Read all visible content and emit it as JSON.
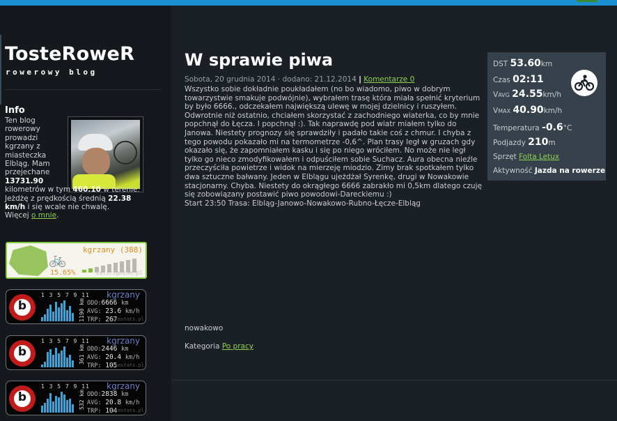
{
  "site": {
    "title": "TosteRoweR",
    "subtitle": "rowerowy blog"
  },
  "info": {
    "heading": "Info",
    "t1": "Ten blog rowerowy prowadzi kgrzany z miasteczka Elbląg. Mam przejechane ",
    "total_km": "13731.90",
    "t2": " kilometrów w tym ",
    "terrain_km": "460.10",
    "t3": " w terenie. Jeżdżę z prędkością średnią ",
    "avg_speed": "22.38 km/h",
    "t4": " i się wcale nie chwalę.",
    "more_prefix": "Więcej ",
    "more_link": "o mnie",
    "more_suffix": "."
  },
  "zaliczgmine": {
    "user": "kgrzany (388)",
    "percent": "15.65%",
    "domain": "zaliczgmine.pl",
    "level_fraction": 0.2
  },
  "bikestats": [
    {
      "user": "kgrzany",
      "months": "1 3 5 7 9 11",
      "year_km": "1190 km",
      "odo_label": "ODO:",
      "odo": "6666",
      "odo_unit": "km",
      "avg_label": "AVG:",
      "avg": "23.6",
      "avg_unit": "km/h",
      "trp_label": "TRP:",
      "trp": "267",
      "domain": "bikestats.pl"
    },
    {
      "user": "kgrzany",
      "months": "1 3 5 7 9 11",
      "year_km": "361 km",
      "odo_label": "ODO:",
      "odo": "2446",
      "odo_unit": "km",
      "avg_label": "AVG:",
      "avg": "20.4",
      "avg_unit": "km/h",
      "trp_label": "TRP:",
      "trp": "105",
      "domain": "bikestats.pl"
    },
    {
      "user": "kgrzany",
      "months": "1 3 5 7 9 11",
      "year_km": "532 km",
      "odo_label": "ODO:",
      "odo": "2838",
      "odo_unit": "km",
      "avg_label": "AVG:",
      "avg": "20.8",
      "avg_unit": "km/h",
      "trp_label": "TRP:",
      "trp": "104",
      "domain": "bikestats.pl"
    }
  ],
  "post": {
    "title": "W sprawie piwa",
    "date": "Sobota, 20 grudnia 2014 · dodano: 21.12.2014",
    "pipe": "|",
    "comments": "Komentarze 0",
    "body": "Wszystko sobie dokładnie poukładałem (no bo wiadomo, piwo w dobrym towarzystwie smakuje podwójnie), wybrałem trasę która miała spełnić kryterium by było 6666., odczekałem największą ulewę w mojej dzielnicy i ruszyłem. Odwrotnie niż ostatnio, chciałem skorzystać z zachodniego wiaterka, co by mnie popchnął do Łęcza. I popchnął :). Tak naprawdę pod wiatr miałem tylko do Janowa. Niestety prognozy się sprawdziły i padało takie coś z chmur. I chyba z tego powodu pokazało mi na termometrze -0,6^. Plan trasy legł w gruzach gdy okazało się, że zapomniałem kasku i się po niego wróciłem. No może nie legł tylko go nieco zmodyfikowałem i odpuściłem sobie Suchacz. Aura obecna nieźle przeczyściła powietrze i widok na mierzeję miodzio. Zimy brak spotkałem tylko dwa sztuczne bałwany. Jeden w Elblągu ujeżdżał Syrenkę, drugi w Nowakowie stacjonarny. Chyba. Niestety do okrągłego 6666 zabrakło mi 0,5km dlatego czuję się zobowiązany postawić piwo powodowi-Dareckiemu :)",
    "route": "Start 23:50 Trasa: Elbląg-Janowo-Nowakowo-Rubno-Łęcze-Elbląg",
    "tag": "nowakowo",
    "category_label": "Kategoria",
    "category": "Po pracy"
  },
  "ride": {
    "dst_label": "DST",
    "dst": "53.60",
    "dst_unit": "km",
    "time_label": "Czas",
    "time": "02:11",
    "vavg_label": "V",
    "vavg_sub": "AVG",
    "vavg": "24.55",
    "vavg_unit": "km/h",
    "vmax_label": "V",
    "vmax_sub": "MAX",
    "vmax": "40.90",
    "vmax_unit": "km/h",
    "temp_label": "Temperatura",
    "temp": "-0.6",
    "temp_unit": "°C",
    "climb_label": "Podjazdy",
    "climb": "210",
    "climb_unit": "m",
    "gear_label": "Sprzęt",
    "gear": "Folta Letux",
    "activity_label": "Aktywność",
    "activity": "Jazda na rowerze",
    "icon": "bicycle-icon"
  },
  "colors": {
    "background": "#1b1f26",
    "sidebar": "#15181d",
    "link": "#8fd14f",
    "panel": "#36414c",
    "accent_top": "#1a8fd1"
  }
}
